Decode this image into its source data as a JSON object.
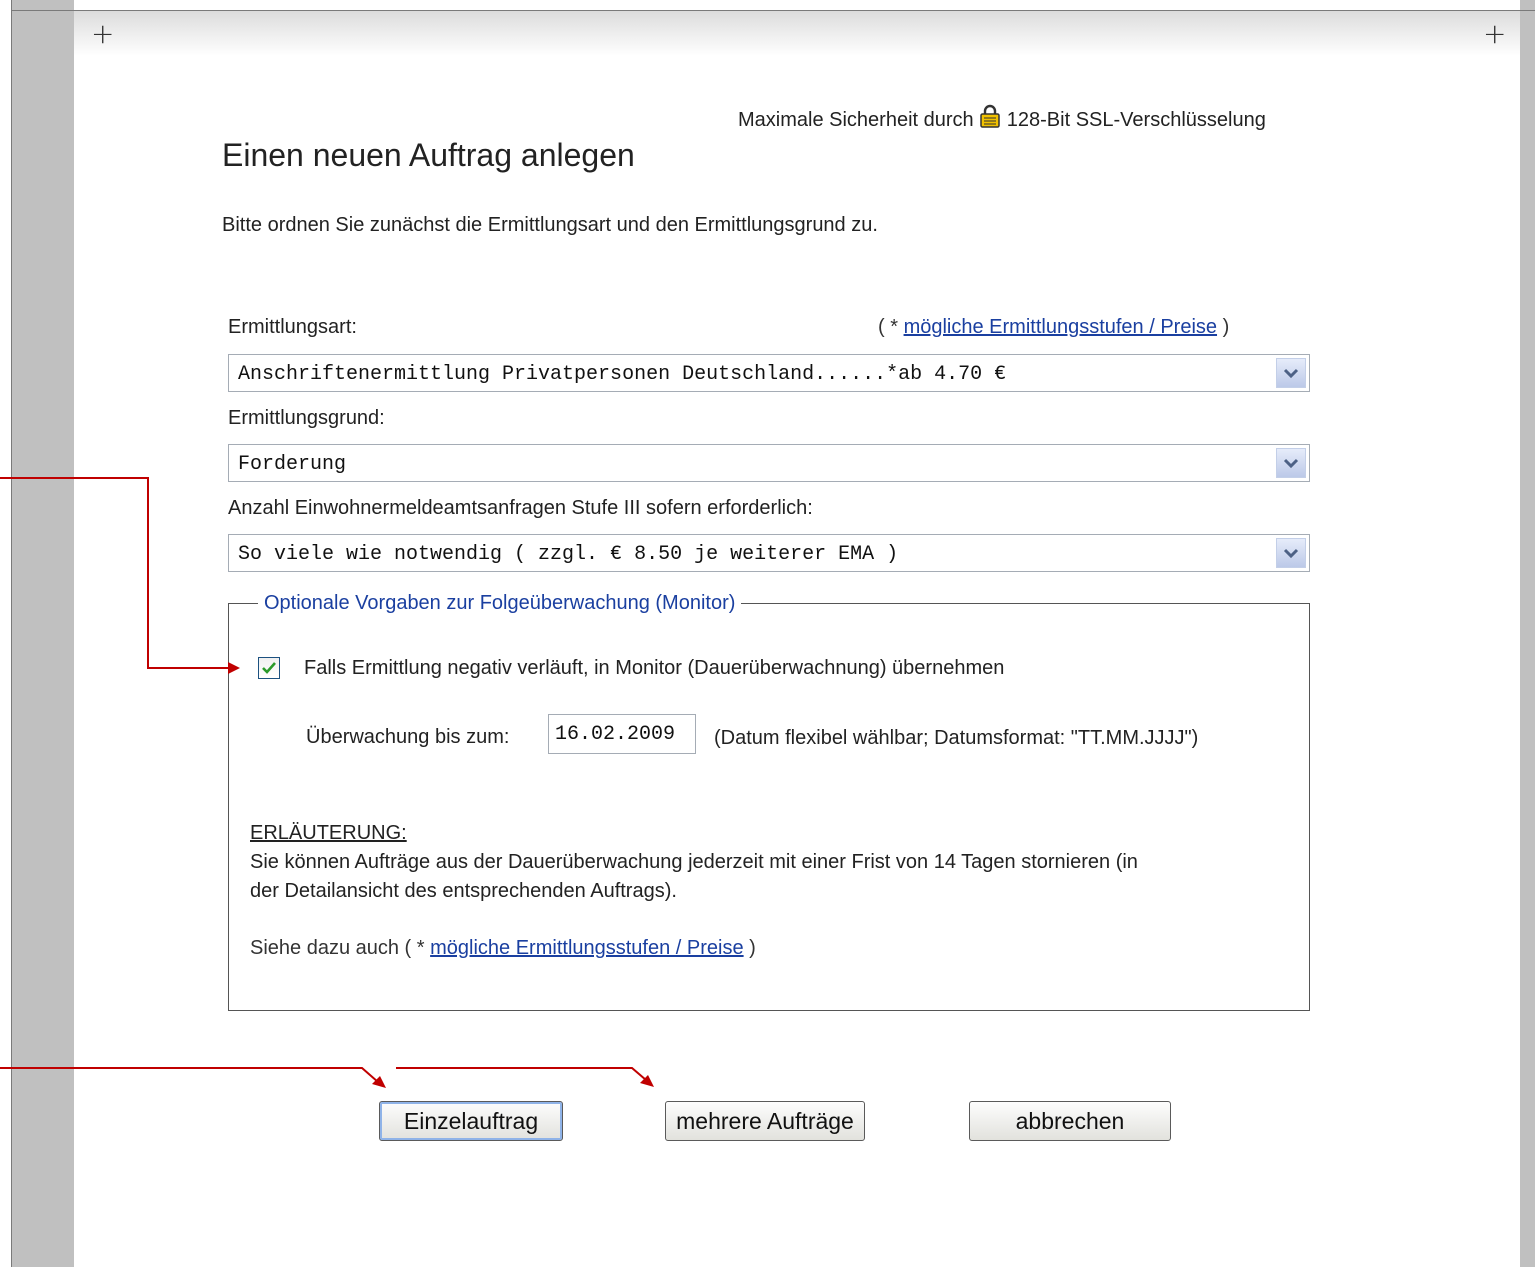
{
  "header": {
    "ssl_prefix": "Maximale Sicherheit durch",
    "ssl_suffix": "128-Bit SSL-Verschlüsselung",
    "title": "Einen neuen Auftrag anlegen",
    "intro": "Bitte ordnen Sie zunächst die Ermittlungsart und den Ermittlungsgrund zu."
  },
  "form": {
    "ermittlungsart_label": "Ermittlungsart:",
    "prices_link_prefix": "( * ",
    "prices_link": "mögliche Ermittlungsstufen / Preise",
    "prices_link_suffix": " )",
    "ermittlungsart_value": "Anschriftenermittlung Privatpersonen Deutschland......*ab 4.70 €",
    "ermittlungsgrund_label": "Ermittlungsgrund:",
    "ermittlungsgrund_value": "Forderung",
    "ema_label": "Anzahl Einwohnermeldeamtsanfragen Stufe III sofern erforderlich:",
    "ema_value": "So viele wie notwendig ( zzgl. € 8.50 je weiterer EMA )"
  },
  "monitor": {
    "legend": "Optionale Vorgaben zur Folgeüberwachung (Monitor)",
    "checkbox_checked": true,
    "checkbox_label": "Falls Ermittlung negativ verläuft, in Monitor (Dauerüberwachnung) übernehmen",
    "date_label": "Überwachung bis zum:",
    "date_value": "16.02.2009",
    "date_hint": "(Datum flexibel wählbar; Datumsformat: \"TT.MM.JJJJ\")",
    "explanation_heading": "ERLÄUTERUNG:",
    "explanation_line1": "Sie können Aufträge aus der Dauerüberwachung jederzeit mit einer Frist von 14 Tagen stornieren (in",
    "explanation_line2": "der Detailansicht des entsprechenden Auftrags).",
    "see_also_prefix": "Siehe dazu auch ( * ",
    "see_also_link": "mögliche Ermittlungsstufen / Preise",
    "see_also_suffix": " )"
  },
  "buttons": {
    "single": "Einzelauftrag",
    "multiple": "mehrere Aufträge",
    "cancel": "abbrechen"
  },
  "colors": {
    "annotation_arrow": "#c00000",
    "link": "#1a3fa0",
    "check": "#2a9a2a"
  }
}
